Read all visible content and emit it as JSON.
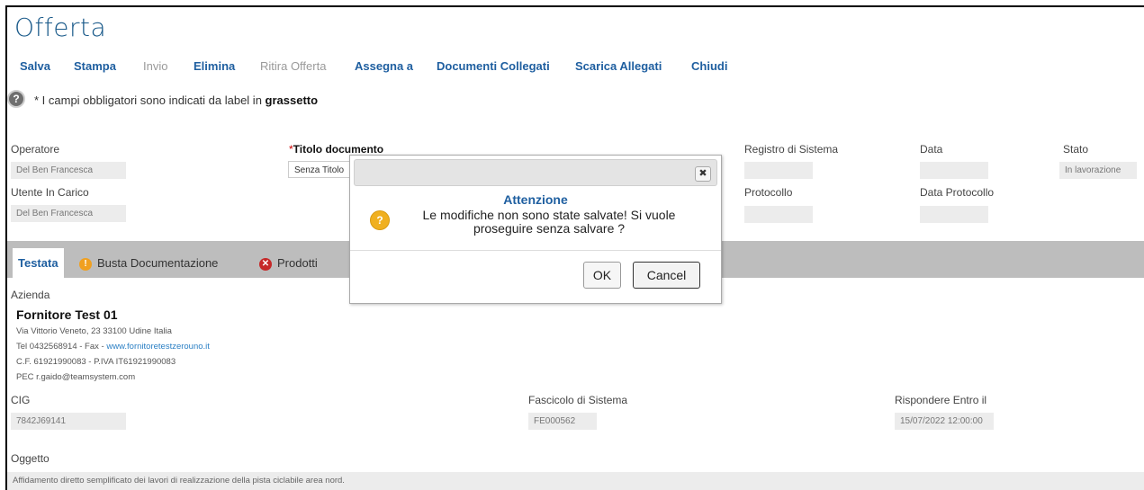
{
  "page": {
    "title": "Offerta",
    "toolbar": [
      {
        "label": "Salva",
        "enabled": true
      },
      {
        "label": "Stampa",
        "enabled": true
      },
      {
        "label": "Invio",
        "enabled": false
      },
      {
        "label": "Elimina",
        "enabled": true
      },
      {
        "label": "Ritira Offerta",
        "enabled": false
      },
      {
        "label": "Assegna a",
        "enabled": true
      },
      {
        "label": "Documenti Collegati",
        "enabled": true
      },
      {
        "label": "Scarica Allegati",
        "enabled": true
      },
      {
        "label": "Chiudi",
        "enabled": true
      }
    ],
    "note_prefix": "* I campi obbligatori sono indicati da label in ",
    "note_bold": "grassetto",
    "help_icon": "help-icon"
  },
  "header_fields": {
    "operatore": {
      "label": "Operatore",
      "value": "Del Ben Francesca"
    },
    "titolo": {
      "star": "*",
      "label": "Titolo documento",
      "value": "Senza Titolo"
    },
    "registro": {
      "label": "Registro di Sistema",
      "value": ""
    },
    "data": {
      "label": "Data",
      "value": ""
    },
    "stato": {
      "label": "Stato",
      "value": "In lavorazione"
    },
    "utente": {
      "label": "Utente In Carico",
      "value": "Del Ben Francesca"
    },
    "protocollo": {
      "label": "Protocollo",
      "value": ""
    },
    "data_protocollo": {
      "label": "Data Protocollo",
      "value": ""
    }
  },
  "tabs": [
    {
      "label": "Testata",
      "active": true,
      "icon": null
    },
    {
      "label": "Busta Documentazione",
      "active": false,
      "icon": "warning-icon"
    },
    {
      "label": "Prodotti",
      "active": false,
      "icon": "error-icon"
    }
  ],
  "azienda": {
    "label": "Azienda",
    "name": "Fornitore Test 01",
    "address": "Via Vittorio Veneto, 23 33100 Udine Italia",
    "phone_line": "Tel 0432568914 - Fax - ",
    "website": "www.fornitoretestzerouno.it",
    "tax_line": "C.F. 61921990083 - P.IVA IT61921990083",
    "pec": "PEC r.gaido@teamsystem.com"
  },
  "details": {
    "cig": {
      "label": "CIG",
      "value": "7842J69141"
    },
    "fascicolo": {
      "label": "Fascicolo di Sistema",
      "value": "FE000562"
    },
    "rispondere": {
      "label": "Rispondere Entro il",
      "value": "15/07/2022 12:00:00"
    },
    "oggetto": {
      "label": "Oggetto",
      "value": "Affidamento diretto semplificato dei lavori di realizzazione della pista ciclabile area nord."
    }
  },
  "dialog": {
    "title": "Attenzione",
    "message": "Le modifiche non sono state salvate! Si vuole proseguire senza salvare ?",
    "ok_label": "OK",
    "cancel_label": "Cancel",
    "close_glyph": "✖",
    "icon": "question-warning-icon"
  },
  "colors": {
    "accent": "#1f5fa0",
    "disabled": "#9a9a9a",
    "tabbar": "#bdbdbd",
    "field_bg": "#ececec",
    "warning": "#f0b020",
    "error": "#c62828"
  }
}
